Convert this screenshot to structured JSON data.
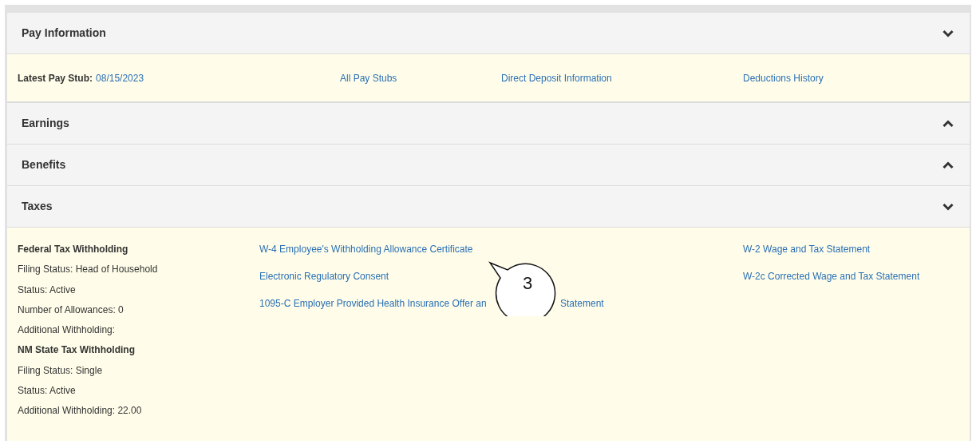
{
  "sections": [
    {
      "title": "Pay Information",
      "expanded": true,
      "kind": "pay",
      "latest_label": "Latest Pay Stub:",
      "latest_link": "08/15/2023",
      "links": [
        "All Pay Stubs",
        "Direct Deposit Information",
        "Deductions History"
      ]
    },
    {
      "title": "Earnings",
      "expanded": false,
      "kind": "collapsed"
    },
    {
      "title": "Benefits",
      "expanded": false,
      "kind": "collapsed"
    },
    {
      "title": "Taxes",
      "expanded": true,
      "kind": "taxes",
      "details": [
        {
          "kind": "heading",
          "text": "Federal Tax Withholding"
        },
        {
          "kind": "text",
          "text": "Filing Status: Head of Household"
        },
        {
          "kind": "text",
          "text": "Status: Active"
        },
        {
          "kind": "text",
          "text": "Number of Allowances: 0"
        },
        {
          "kind": "text",
          "text": "Additional Withholding:"
        },
        {
          "kind": "heading",
          "text": "NM State Tax Withholding"
        },
        {
          "kind": "text",
          "text": "Filing Status: Single"
        },
        {
          "kind": "text",
          "text": "Status: Active"
        },
        {
          "kind": "text",
          "text": "Additional Withholding: 22.00"
        }
      ],
      "forms": [
        {
          "parts": [
            "W-4 Employee's Withholding Allowance Certificate"
          ]
        },
        {
          "parts": [
            "Electronic Regulatory Consent"
          ]
        },
        {
          "parts": [
            "1095-C Employer Provided Health Insurance Offer an",
            "Statement"
          ]
        }
      ],
      "statements": [
        "W-2 Wage and Tax Statement",
        "W-2c Corrected Wage and Tax Statement"
      ]
    }
  ],
  "callout": {
    "label": "3"
  }
}
